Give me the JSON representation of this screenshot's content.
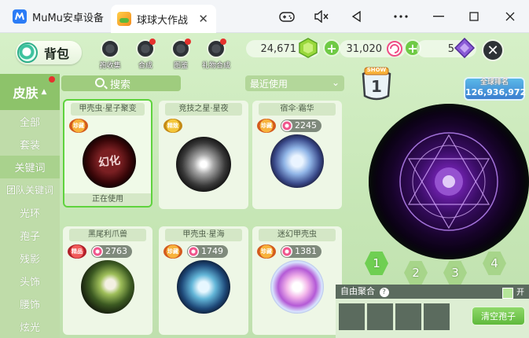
{
  "window": {
    "tab1_title": "MuMu安卓设备",
    "tab2_title": "球球大作战",
    "close_label": "✕"
  },
  "topbar": {
    "bag_label": "背包",
    "nav": [
      {
        "label": "孢收集"
      },
      {
        "label": "合成"
      },
      {
        "label": "图鉴"
      },
      {
        "label": "礼物合成"
      }
    ],
    "currency": [
      {
        "value": "24,671",
        "icon": "green-gem-icon"
      },
      {
        "value": "31,020",
        "icon": "candy-coin-icon"
      },
      {
        "value": "5",
        "icon": "purple-gem-icon"
      }
    ]
  },
  "sidebar": {
    "header": "皮肤",
    "items": [
      {
        "label": "全部"
      },
      {
        "label": "套装"
      },
      {
        "label": "关键词"
      },
      {
        "label": "团队关键词"
      },
      {
        "label": "光环"
      },
      {
        "label": "孢子"
      },
      {
        "label": "残影"
      },
      {
        "label": "头饰"
      },
      {
        "label": "腰饰"
      },
      {
        "label": "炫光"
      }
    ],
    "active_index": 2
  },
  "search": {
    "placeholder": "搜索",
    "sort_label": "最近使用"
  },
  "cards": [
    {
      "name": "甲壳虫·星子聚变",
      "badge": "珍藏",
      "price": "",
      "status": "正在使用",
      "ball_text": "幻化"
    },
    {
      "name": "竞技之星·星夜",
      "badge": "精致",
      "price": "",
      "status": ""
    },
    {
      "name": "宿伞·霜华",
      "badge": "珍藏",
      "price": "2245",
      "status": ""
    },
    {
      "name": "黑尾利爪兽",
      "badge": "精品",
      "price": "2763",
      "status": ""
    },
    {
      "name": "甲壳虫·星海",
      "badge": "珍藏",
      "price": "1749",
      "status": ""
    },
    {
      "name": "迷幻甲壳虫",
      "badge": "珍藏",
      "price": "1381",
      "status": ""
    }
  ],
  "preview": {
    "show_label": "SHOW",
    "show_number": "1",
    "rank_label": "全球排名",
    "rank_value": "126,936,972",
    "slots": [
      "1",
      "2",
      "3",
      "4"
    ],
    "active_slot": 0
  },
  "spore": {
    "title": "自由聚合",
    "toggle_label": "开",
    "clear_button": "清空孢子"
  },
  "colors": {
    "accent_green": "#6fca45",
    "panel_dark": "#5b6b5e",
    "close_dark": "#2d3136"
  }
}
